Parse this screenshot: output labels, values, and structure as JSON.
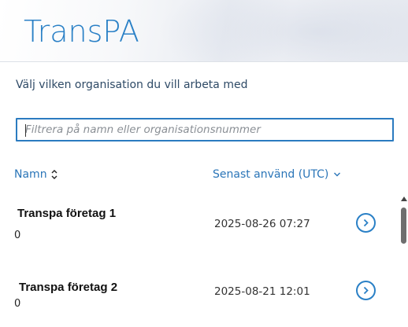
{
  "app": {
    "title": "TransPA"
  },
  "page": {
    "subtitle": "Välj vilken organisation du vill arbeta med"
  },
  "filter": {
    "placeholder": "Filtrera på namn eller organisationsnummer",
    "value": ""
  },
  "columns": {
    "name": {
      "label": "Namn",
      "icon": "sort-updown-icon"
    },
    "last_used": {
      "label": "Senast använd (UTC)",
      "icon": "chevron-down-icon"
    }
  },
  "organizations": [
    {
      "name": "Transpa företag 1",
      "number": "0",
      "last_used": "2025-08-26 07:27"
    },
    {
      "name": "Transpa företag 2",
      "number": "0",
      "last_used": "2025-08-21 12:01"
    }
  ],
  "colors": {
    "accent": "#2a80c6",
    "link": "#2a75b8"
  }
}
